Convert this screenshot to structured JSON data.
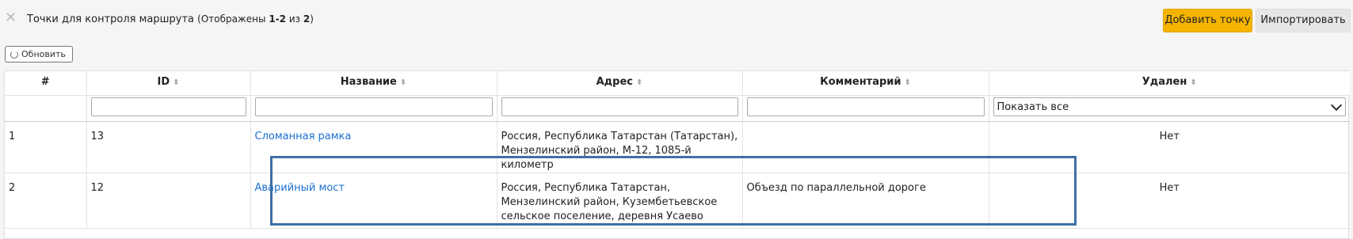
{
  "header": {
    "title": "Точки для контроля маршрута",
    "subtitle_prefix": "(Отображены ",
    "range": "1-2",
    "of": " из ",
    "total": "2",
    "subtitle_suffix": ")",
    "add_button": "Добавить точку",
    "import_button": "Импортировать"
  },
  "toolbar": {
    "refresh_label": "Обновить"
  },
  "table": {
    "columns": [
      "#",
      "ID",
      "Название",
      "Адрес",
      "Комментарий",
      "Удален"
    ],
    "filter_deleted_value": "Показать все",
    "rows": [
      {
        "num": "1",
        "id": "13",
        "name": "Сломанная рамка",
        "address": "Россия, Республика Татарстан (Татарстан), Мензелинский район, М-12, 1085-й километр",
        "comment": "",
        "deleted": "Нет"
      },
      {
        "num": "2",
        "id": "12",
        "name": "Аварийный мост",
        "address": "Россия, Республика Татарстан, Мензелинский район, Кузембетьевское сельское поселение, деревня Усаево",
        "comment": "Объезд по параллельной дороге",
        "deleted": "Нет"
      }
    ]
  },
  "icons": {
    "close": "close-icon",
    "refresh": "refresh-icon",
    "sort": "sort-icon",
    "dropdown": "chevron-down-icon"
  },
  "colors": {
    "add_button": "#f5b400",
    "link": "#1a6fd1",
    "highlight": "#3d70a8"
  }
}
